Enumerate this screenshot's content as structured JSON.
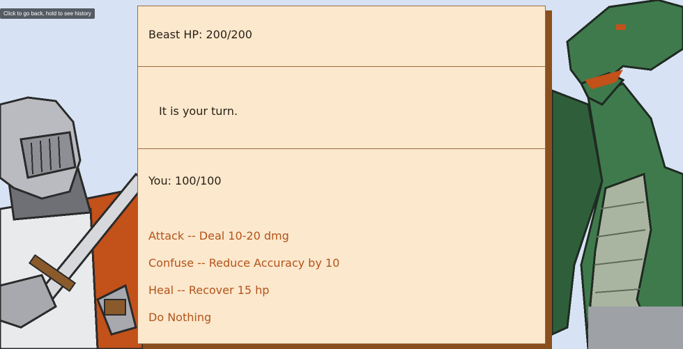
{
  "browser": {
    "back_tooltip": "Click to go back, hold to see history"
  },
  "battle": {
    "beast_hp": "Beast HP: 200/200",
    "message": "It is your turn.",
    "player_hp": "You: 100/100",
    "actions": [
      {
        "label": "Attack -- Deal 10-20 dmg"
      },
      {
        "label": "Confuse -- Reduce Accuracy by 10"
      },
      {
        "label": "Heal -- Recover 15 hp"
      },
      {
        "label": "Do Nothing"
      }
    ]
  },
  "colors": {
    "background": "#d7e3f4",
    "panel": "#fbe8cd",
    "panel_border": "#9a6a3f",
    "panel_shadow": "#8a4f1e",
    "action_text": "#b3531a",
    "body_text": "#2a2118",
    "dragon_green": "#3f7a4c",
    "knight_orange": "#c2511a"
  },
  "sprites": {
    "left": "knight-sprite",
    "right": "dragon-sprite"
  }
}
